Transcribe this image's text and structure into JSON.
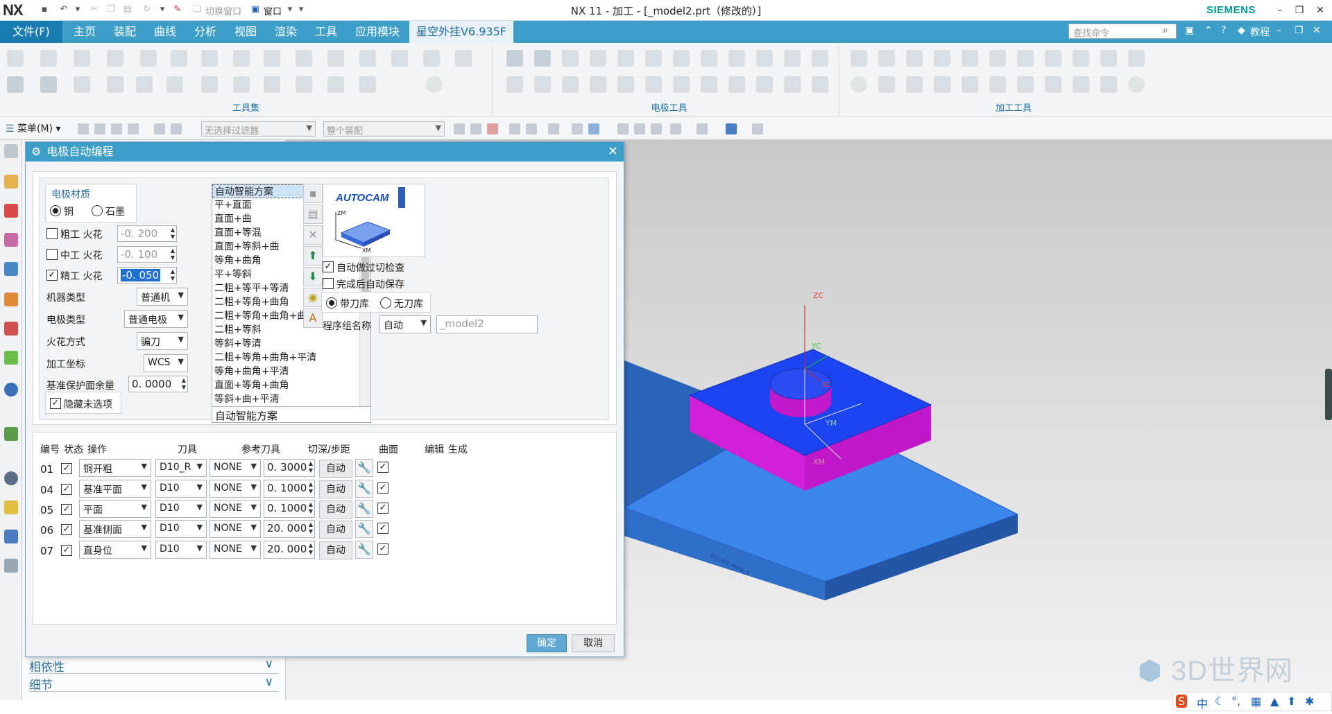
{
  "titlebar": {
    "logo": "NX",
    "switch_window_label": "切换窗口",
    "window_menu_label": "窗口",
    "title": "NX 11 - 加工 - [_model2.prt（修改的）]",
    "brand": "SIEMENS"
  },
  "tabs": [
    {
      "label": "文件(F)"
    },
    {
      "label": "主页"
    },
    {
      "label": "装配"
    },
    {
      "label": "曲线"
    },
    {
      "label": "分析"
    },
    {
      "label": "视图"
    },
    {
      "label": "渲染"
    },
    {
      "label": "工具"
    },
    {
      "label": "应用模块"
    },
    {
      "label": "星空外挂V6.935F"
    }
  ],
  "search_placeholder": "查找命令",
  "tutorial_label": "教程",
  "ribbon_groups": [
    {
      "label": "工具集"
    },
    {
      "label": "电极工具"
    },
    {
      "label": "加工工具"
    }
  ],
  "selbar": {
    "menu_label": "菜单(M)",
    "filter_placeholder": "无选择过滤器",
    "assembly_placeholder": "整个装配"
  },
  "nav_sections": [
    {
      "label": "相依性"
    },
    {
      "label": "细节"
    }
  ],
  "dialog": {
    "title": "电极自动编程",
    "material": {
      "group_label": "电极材质",
      "copper": "铜",
      "graphite": "石墨",
      "selected": "铜"
    },
    "spark": [
      {
        "label": "粗工 火花",
        "value": "-0. 200",
        "checked": false
      },
      {
        "label": "中工 火花",
        "value": "-0. 100",
        "checked": false
      },
      {
        "label": "精工 火花",
        "value": "-0. 050",
        "checked": true
      }
    ],
    "fields": [
      {
        "label": "机器类型",
        "value": "普通机"
      },
      {
        "label": "电极类型",
        "value": "普通电极"
      },
      {
        "label": "火花方式",
        "value": "骗刀"
      },
      {
        "label": "加工坐标",
        "value": "WCS"
      }
    ],
    "base_protect": {
      "label": "基准保护面余量",
      "value": "0. 0000"
    },
    "hide_unselected": "隐藏未选项",
    "plans": [
      "自动智能方案",
      "平+直面",
      "直面+曲",
      "直面+等混",
      "直面+等斜+曲",
      "等角+曲角",
      "平+等斜",
      "二粗+等平+等清",
      "二粗+等角+曲角",
      "二粗+等角+曲角+曲清",
      "二粗+等斜",
      "等斜+等清",
      "二粗+等角+曲角+平清",
      "等角+曲角+平清",
      "直面+等角+曲角",
      "等斜+曲+平清",
      "等斜+曲"
    ],
    "plan_current": "自动智能方案",
    "autocam_logo": "AUTOCAM",
    "autocam_axes": {
      "zm": "ZM",
      "xm": "XM"
    },
    "auto_check": "自动做过切检查",
    "auto_save": "完成后自动保存",
    "tool_lib": "带刀库",
    "no_tool_lib": "无刀库",
    "group_name_label": "程序组名称",
    "group_name_value": "自动",
    "group_name_text": "_model2",
    "op_headers": {
      "num": "编号",
      "status": "状态",
      "op": "操作",
      "tool": "刀具",
      "ref_tool": "参考刀具",
      "depth": "切深/步距",
      "surface": "曲面",
      "edit": "编辑",
      "gen": "生成"
    },
    "operations": [
      {
        "num": "01",
        "op": "铜开粗",
        "tool": "D10_R",
        "ref": "NONE",
        "depth": "0. 3000",
        "surface": "自动"
      },
      {
        "num": "04",
        "op": "基准平面",
        "tool": "D10",
        "ref": "NONE",
        "depth": "0. 1000",
        "surface": "自动"
      },
      {
        "num": "05",
        "op": "平面",
        "tool": "D10",
        "ref": "NONE",
        "depth": "0. 1000",
        "surface": "自动"
      },
      {
        "num": "06",
        "op": "基准侧面",
        "tool": "D10",
        "ref": "NONE",
        "depth": "20. 000",
        "surface": "自动"
      },
      {
        "num": "07",
        "op": "直身位",
        "tool": "D10",
        "ref": "NONE",
        "depth": "20. 000",
        "surface": "自动"
      }
    ],
    "ok": "确定",
    "cancel": "取消"
  },
  "viewport": {
    "axis_zc": "ZC",
    "axis_xc": "XC",
    "axis_yc": "YC",
    "axis_ym": "YM",
    "axis_xm": "XM",
    "watermark": "3D世界网",
    "ime": "中"
  },
  "colors": {
    "accent": "#3d9fc8",
    "plate_top": "#3b86e8",
    "block_top": "#1c43f0",
    "block_side": "#d020d8"
  }
}
